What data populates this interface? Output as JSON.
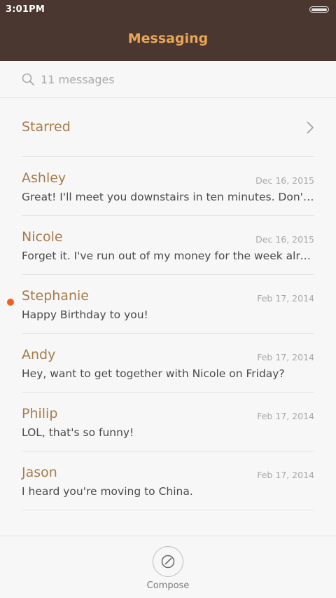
{
  "status_bar": {
    "time": "3:01PM"
  },
  "header": {
    "title": "Messaging"
  },
  "search": {
    "placeholder": "11 messages"
  },
  "starred": {
    "label": "Starred"
  },
  "messages": [
    {
      "name": "Ashley",
      "date": "Dec 16, 2015",
      "preview": "Great! I'll meet you downstairs in ten minutes. Don't forget to bring the tickets.",
      "unread": false
    },
    {
      "name": "Nicole",
      "date": "Dec 16, 2015",
      "preview": "Forget it. I've run out of my money for the week already.",
      "unread": false
    },
    {
      "name": "Stephanie",
      "date": "Feb 17, 2014",
      "preview": "Happy Birthday to you!",
      "unread": true
    },
    {
      "name": "Andy",
      "date": "Feb 17, 2014",
      "preview": "Hey, want to get together with Nicole on Friday?",
      "unread": false
    },
    {
      "name": "Philip",
      "date": "Feb 17, 2014",
      "preview": "LOL, that's so funny!",
      "unread": false
    },
    {
      "name": "Jason",
      "date": "Feb 17, 2014",
      "preview": "I heard you're moving to China.",
      "unread": false
    }
  ],
  "bottom_bar": {
    "compose_label": "Compose"
  },
  "colors": {
    "header_bg": "#4a3830",
    "title": "#e9a657",
    "name": "#a67b4b",
    "unread_dot": "#f4601c",
    "background": "#f7f7f7"
  }
}
